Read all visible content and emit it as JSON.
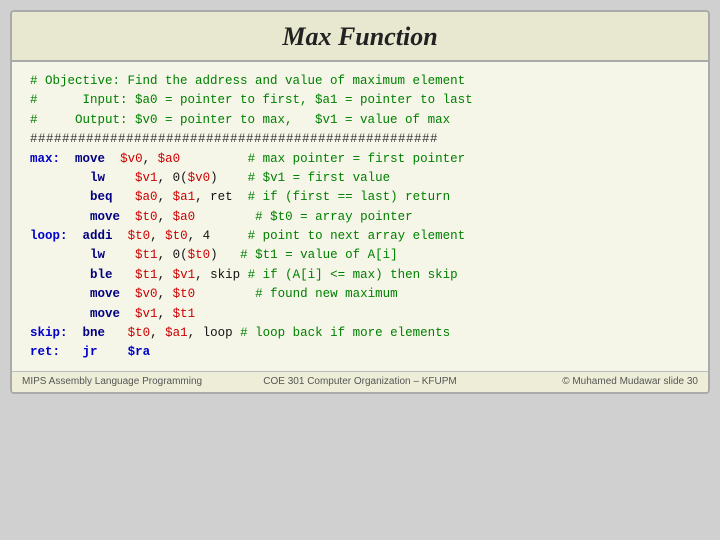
{
  "title": "Max Function",
  "footer": {
    "left": "MIPS Assembly Language Programming",
    "center": "COE 301 Computer Organization – KFUPM",
    "right": "© Muhamed Mudawar  slide 30"
  },
  "code": {
    "line1": "# Objective: Find the address and value of maximum element",
    "line2": "#      Input: $a0 = pointer to first, $a1 = pointer to last",
    "line3": "#     Output: $v0 = pointer to max,   $v1 = value of max",
    "hashline": "###################################################",
    "body": [
      {
        "label": "max:",
        "instr": "  move",
        "args": "  $v0, $a0         ",
        "comment": "# max pointer = first pointer"
      },
      {
        "label": "",
        "instr": "        lw",
        "args": "    $v1, 0($v0)    ",
        "comment": "# $v1 = first value"
      },
      {
        "label": "",
        "instr": "        beq",
        "args": "   $a0, $a1, ret  ",
        "comment": "# if (first == last) return"
      },
      {
        "label": "",
        "instr": "        move",
        "args": "  $t0, $a0        ",
        "comment": "# $t0 = array pointer"
      },
      {
        "label": "loop:",
        "instr": " addi",
        "args": "  $t0, $t0, 4     ",
        "comment": "# point to next array element"
      },
      {
        "label": "",
        "instr": "        lw",
        "args": "    $t1, 0($t0)   ",
        "comment": "# $t1 = value of A[i]"
      },
      {
        "label": "",
        "instr": "        ble",
        "args": "   $t1, $v1, skip ",
        "comment": "# if (A[i] <= max) then skip"
      },
      {
        "label": "",
        "instr": "        move",
        "args": "  $v0, $t0        ",
        "comment": "# found new maximum"
      },
      {
        "label": "",
        "instr": "        move",
        "args": "  $v1, $t1        ",
        "comment": ""
      },
      {
        "label": "skip:",
        "instr": " bne",
        "args": "   $t0, $a1, loop ",
        "comment": "# loop back if more elements"
      },
      {
        "label": "ret:",
        "instr": "  jr",
        "args": "    $ra            ",
        "comment": "",
        "ra": true
      }
    ]
  }
}
